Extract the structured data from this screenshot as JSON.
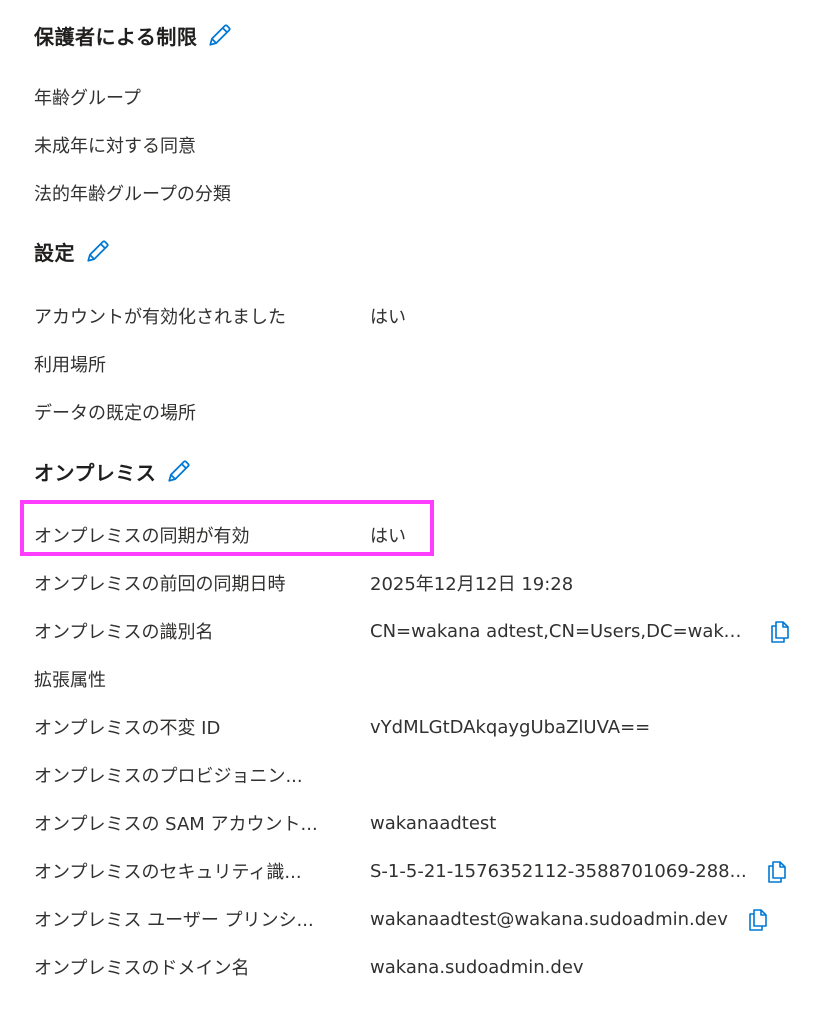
{
  "sections": {
    "parental": {
      "title": "保護者による制限",
      "rows": [
        {
          "label": "年齢グループ",
          "value": ""
        },
        {
          "label": "未成年に対する同意",
          "value": ""
        },
        {
          "label": "法的年齢グループの分類",
          "value": ""
        }
      ]
    },
    "settings": {
      "title": "設定",
      "rows": [
        {
          "label": "アカウントが有効化されました",
          "value": "はい"
        },
        {
          "label": "利用場所",
          "value": ""
        },
        {
          "label": "データの既定の場所",
          "value": ""
        }
      ]
    },
    "onprem": {
      "title": "オンプレミス",
      "rows": [
        {
          "label": "オンプレミスの同期が有効",
          "value": "はい"
        },
        {
          "label": "オンプレミスの前回の同期日時",
          "value": "2025年12月12日 19:28"
        },
        {
          "label": "オンプレミスの識別名",
          "value": "CN=wakana adtest,CN=Users,DC=waka..."
        },
        {
          "label": "拡張属性",
          "value": ""
        },
        {
          "label": "オンプレミスの不変 ID",
          "value": "vYdMLGtDAkqaygUbaZlUVA=="
        },
        {
          "label": "オンプレミスのプロビジョニン...",
          "value": ""
        },
        {
          "label": "オンプレミスの SAM アカウント...",
          "value": "wakanaadtest"
        },
        {
          "label": "オンプレミスのセキュリティ識...",
          "value": "S-1-5-21-1576352112-3588701069-288..."
        },
        {
          "label": "オンプレミス ユーザー プリンシ...",
          "value": "wakanaadtest@wakana.sudoadmin.dev"
        },
        {
          "label": "オンプレミスのドメイン名",
          "value": "wakana.sudoadmin.dev"
        }
      ]
    }
  },
  "colors": {
    "accent": "#0078d4",
    "highlight": "#ff3dff"
  },
  "icons": {
    "edit": "pencil-icon",
    "copy": "copy-icon"
  }
}
